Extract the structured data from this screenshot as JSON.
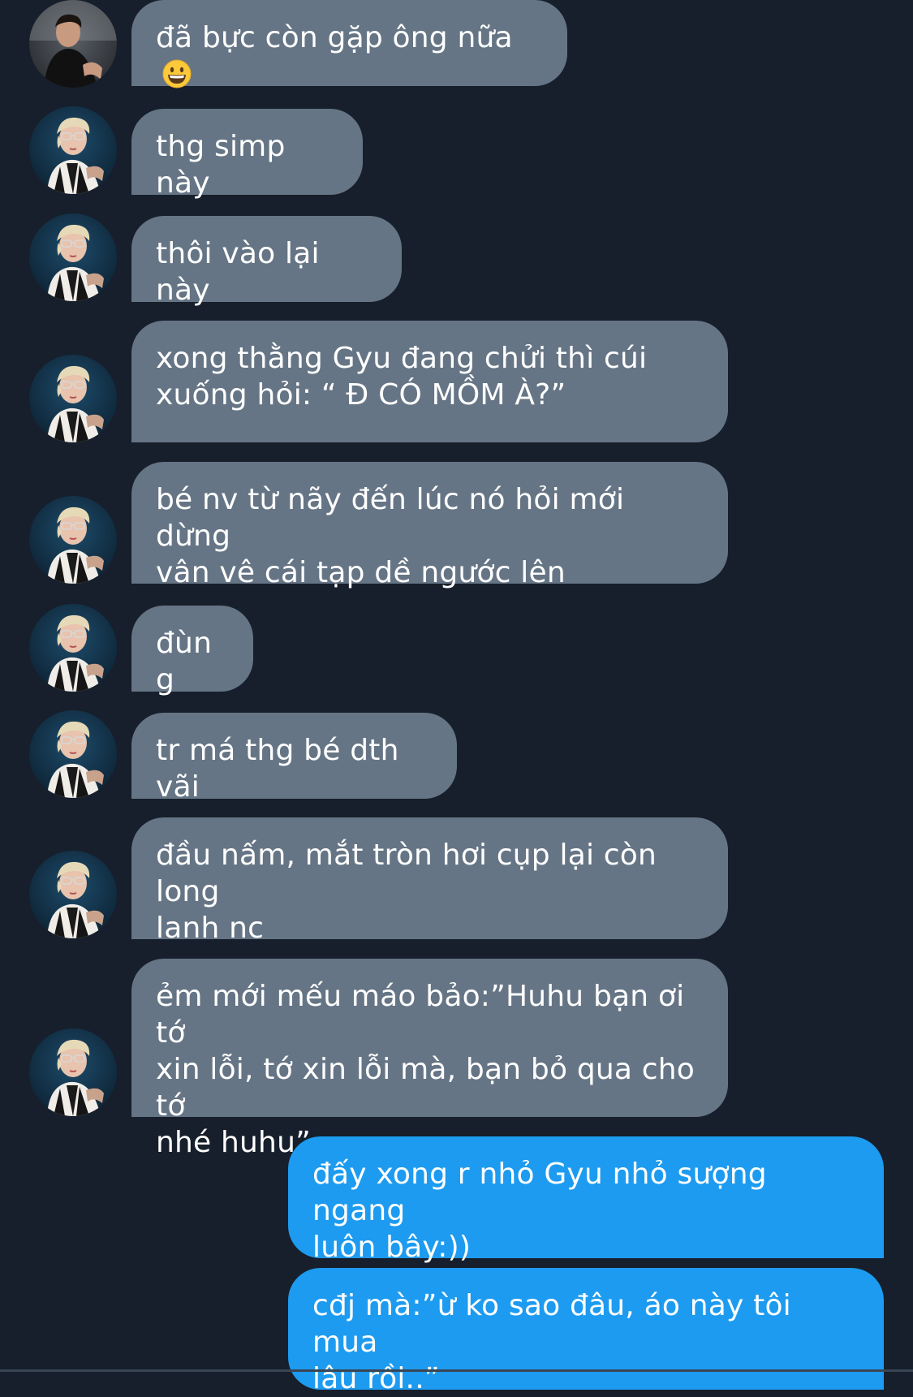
{
  "conversation": {
    "messages": [
      {
        "sender": "other",
        "text": "đã bực còn gặp ông nữa",
        "emoji": "grinning-face-emoji"
      },
      {
        "sender": "other",
        "text": "thg simp này"
      },
      {
        "sender": "other",
        "text": "thôi vào lại này"
      },
      {
        "sender": "other",
        "text": "xong thằng Gyu đang chửi thì cúi\nxuống hỏi: “ Đ CÓ MỒM À?”"
      },
      {
        "sender": "other",
        "text": "bé nv từ nãy đến lúc nó hỏi mới dừng\nvân vê cái tạp dề ngước lên"
      },
      {
        "sender": "other",
        "text": "đùng"
      },
      {
        "sender": "other",
        "text": "tr má thg bé dth vãi"
      },
      {
        "sender": "other",
        "text": "đầu nấm, mắt tròn hơi cụp lại còn long\nlanh nc"
      },
      {
        "sender": "other",
        "text": "ẻm mới mếu máo bảo:”Huhu bạn ơi tớ\nxin lỗi, tớ xin lỗi mà, bạn bỏ qua cho tớ\nnhé huhu”"
      },
      {
        "sender": "me",
        "text": "đấy xong r nhỏ Gyu nhỏ sượng ngang\nluôn bây:))"
      },
      {
        "sender": "me",
        "text": "cđj mà:”ừ ko sao đâu, áo này tôi mua\nlâu rồi..”"
      }
    ]
  },
  "theme": {
    "background": "#161f2b",
    "received_bubble": "#667585",
    "sent_bubble": "#1d9bf0",
    "text": "#ffffff"
  }
}
